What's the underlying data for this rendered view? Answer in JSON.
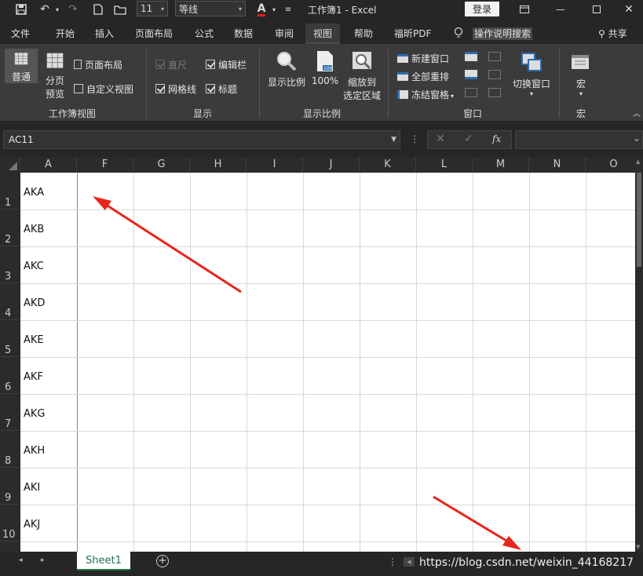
{
  "titlebar": {
    "font_size": "11",
    "font_name": "等线",
    "title": "工作簿1  -  Excel",
    "login": "登录"
  },
  "tabs": [
    "文件",
    "开始",
    "插入",
    "页面布局",
    "公式",
    "数据",
    "审阅",
    "视图",
    "帮助",
    "福昕PDF"
  ],
  "active_tab": "视图",
  "tell_me": "操作说明搜索",
  "share": "共享",
  "ribbon": {
    "workbook_views": {
      "label": "工作簿视图",
      "normal": "普通",
      "page_break_1": "分页",
      "page_break_2": "预览",
      "page_layout": "页面布局",
      "custom_views": "自定义视图"
    },
    "show": {
      "label": "显示",
      "ruler": "直尺",
      "formula_bar": "编辑栏",
      "gridlines": "网格线",
      "headings": "标题"
    },
    "zoom": {
      "label": "显示比例",
      "zoom": "显示比例",
      "hundred": "100%",
      "zoom_sel_1": "缩放到",
      "zoom_sel_2": "选定区域"
    },
    "window": {
      "label": "窗口",
      "new_window": "新建窗口",
      "arrange_all": "全部重排",
      "freeze_panes": "冻结窗格",
      "switch_windows": "切换窗口"
    },
    "macros": {
      "label": "宏",
      "macros": "宏"
    }
  },
  "namebox": "AC11",
  "fx": "fx",
  "columns": [
    "A",
    "F",
    "G",
    "H",
    "I",
    "J",
    "K",
    "L",
    "M",
    "N",
    "O"
  ],
  "rows": [
    {
      "num": "1",
      "value": "AKA"
    },
    {
      "num": "2",
      "value": "AKB"
    },
    {
      "num": "3",
      "value": "AKC"
    },
    {
      "num": "4",
      "value": "AKD"
    },
    {
      "num": "5",
      "value": "AKE"
    },
    {
      "num": "6",
      "value": "AKF"
    },
    {
      "num": "7",
      "value": "AKG"
    },
    {
      "num": "8",
      "value": "AKH"
    },
    {
      "num": "9",
      "value": "AKI"
    },
    {
      "num": "10",
      "value": "AKJ"
    }
  ],
  "sheet_tab": "Sheet1",
  "watermark": "https://blog.csdn.net/weixin_44168217"
}
